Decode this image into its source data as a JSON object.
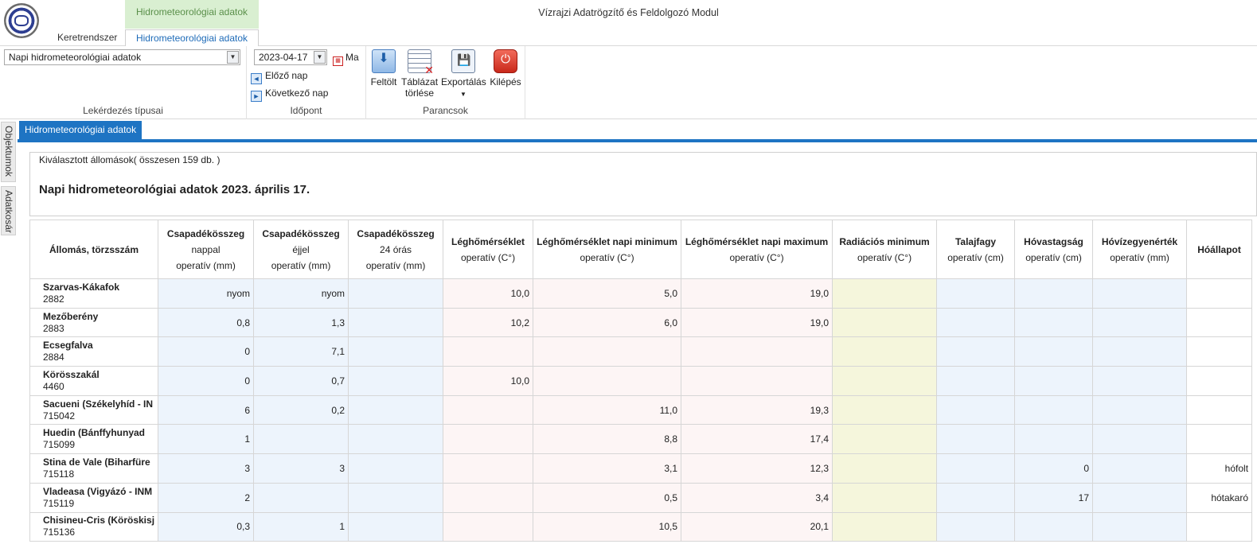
{
  "app": {
    "title": "Vízrajzi Adatrögzítő és Feldolgozó Modul",
    "context_header": "Hidrometeorológiai adatok",
    "tabs": [
      "Keretrendszer",
      "Hidrometeorológiai adatok"
    ]
  },
  "ribbon": {
    "query_type": {
      "value": "Napi hidrometeorológiai adatok",
      "label": "Lekérdezés típusai"
    },
    "time": {
      "date": "2023-04-17",
      "today_label": "Ma",
      "prev_label": "Előző nap",
      "next_label": "Következő nap",
      "label": "Időpont"
    },
    "commands": {
      "upload": "Feltölt",
      "clear_line1": "Táblázat",
      "clear_line2": "törlése",
      "export": "Exportálás",
      "exit": "Kilépés",
      "label": "Parancsok"
    }
  },
  "side_tabs": [
    "Objektumok",
    "Adatkosár"
  ],
  "doc_tab": "Hidrometeorológiai adatok",
  "selected_stations": "Kiválasztott állomások( összesen 159 db. )",
  "heading": "Napi hidrometeorológiai adatok 2023. április 17.",
  "table": {
    "columns": [
      {
        "title": "Állomás, törzsszám",
        "sub1": "",
        "sub2": ""
      },
      {
        "title": "Csapadékösszeg",
        "sub1": "nappal",
        "sub2": "operatív (mm)"
      },
      {
        "title": "Csapadékösszeg",
        "sub1": "éjjel",
        "sub2": "operatív (mm)"
      },
      {
        "title": "Csapadékösszeg",
        "sub1": "24 órás",
        "sub2": "operatív (mm)"
      },
      {
        "title": "Léghőmérséklet",
        "sub1": "operatív (C°)",
        "sub2": ""
      },
      {
        "title": "Léghőmérséklet napi minimum",
        "sub1": "operatív (C°)",
        "sub2": ""
      },
      {
        "title": "Léghőmérséklet napi maximum",
        "sub1": "operatív (C°)",
        "sub2": ""
      },
      {
        "title": "Radiációs minimum",
        "sub1": "operatív (C°)",
        "sub2": ""
      },
      {
        "title": "Talajfagy",
        "sub1": "operatív (cm)",
        "sub2": ""
      },
      {
        "title": "Hóvastagság",
        "sub1": "operatív (cm)",
        "sub2": ""
      },
      {
        "title": "Hóvízegyenérték",
        "sub1": "operatív (mm)",
        "sub2": ""
      },
      {
        "title": "Hóállapot",
        "sub1": "",
        "sub2": ""
      }
    ],
    "rows": [
      {
        "name": "Szarvas-Kákafok",
        "code": "2882",
        "values": [
          "nyom",
          "nyom",
          "",
          "10,0",
          "5,0",
          "19,0",
          "",
          "",
          "",
          "",
          ""
        ]
      },
      {
        "name": "Mezőberény",
        "code": "2883",
        "values": [
          "0,8",
          "1,3",
          "",
          "10,2",
          "6,0",
          "19,0",
          "",
          "",
          "",
          "",
          ""
        ]
      },
      {
        "name": "Ecsegfalva",
        "code": "2884",
        "values": [
          "0",
          "7,1",
          "",
          "",
          "",
          "",
          "",
          "",
          "",
          "",
          ""
        ]
      },
      {
        "name": "Körösszakál",
        "code": "4460",
        "values": [
          "0",
          "0,7",
          "",
          "10,0",
          "",
          "",
          "",
          "",
          "",
          "",
          ""
        ]
      },
      {
        "name": "Sacueni (Székelyhíd - IN",
        "code": "715042",
        "values": [
          "6",
          "0,2",
          "",
          "",
          "11,0",
          "19,3",
          "",
          "",
          "",
          "",
          ""
        ]
      },
      {
        "name": "Huedin (Bánffyhunyad",
        "code": "715099",
        "values": [
          "1",
          "",
          "",
          "",
          "8,8",
          "17,4",
          "",
          "",
          "",
          "",
          ""
        ]
      },
      {
        "name": "Stina de Vale (Biharfüre",
        "code": "715118",
        "values": [
          "3",
          "3",
          "",
          "",
          "3,1",
          "12,3",
          "",
          "",
          "0",
          "",
          "hófolt"
        ]
      },
      {
        "name": "Vladeasa (Vigyázó - INM",
        "code": "715119",
        "values": [
          "2",
          "",
          "",
          "",
          "0,5",
          "3,4",
          "",
          "",
          "17",
          "",
          "hótakaró"
        ]
      },
      {
        "name": "Chisineu-Cris (Köröskisj",
        "code": "715136",
        "values": [
          "0,3",
          "1",
          "",
          "",
          "10,5",
          "20,1",
          "",
          "",
          "",
          "",
          ""
        ]
      }
    ]
  }
}
